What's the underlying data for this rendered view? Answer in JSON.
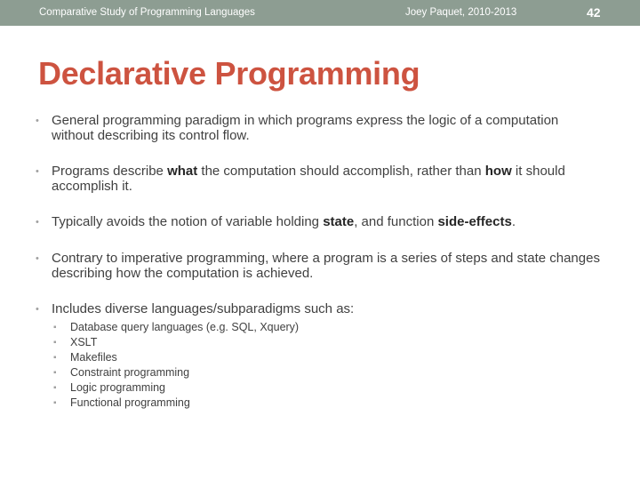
{
  "header": {
    "course": "Comparative Study of Programming Languages",
    "author": "Joey Paquet, 2010-2013",
    "page_number": "42"
  },
  "title": "Declarative Programming",
  "bullet_glyph": "•",
  "bullets": [
    {
      "segments": [
        {
          "text": "General programming paradigm in which programs express the logic of a computation without describing its control flow.",
          "bold": false
        }
      ]
    },
    {
      "segments": [
        {
          "text": "Programs describe ",
          "bold": false
        },
        {
          "text": "what",
          "bold": true
        },
        {
          "text": " the computation should accomplish, rather than ",
          "bold": false
        },
        {
          "text": "how",
          "bold": true
        },
        {
          "text": " it should accomplish it.",
          "bold": false
        }
      ]
    },
    {
      "segments": [
        {
          "text": "Typically avoids the notion of variable holding ",
          "bold": false
        },
        {
          "text": "state",
          "bold": true
        },
        {
          "text": ", and function ",
          "bold": false
        },
        {
          "text": "side-effects",
          "bold": true
        },
        {
          "text": ".",
          "bold": false
        }
      ]
    },
    {
      "segments": [
        {
          "text": "Contrary to imperative programming, where a program is a series of steps and state changes describing how the computation is achieved.",
          "bold": false
        }
      ]
    },
    {
      "segments": [
        {
          "text": "Includes diverse languages/subparadigms such as:",
          "bold": false
        }
      ]
    }
  ],
  "sub_bullets": [
    "Database query languages (e.g. SQL, Xquery)",
    "XSLT",
    "Makefiles",
    "Constraint programming",
    "Logic programming",
    "Functional programming"
  ],
  "colors": {
    "header_bar": "#8d9d92",
    "title": "#cd5340",
    "body_text": "#404040"
  }
}
